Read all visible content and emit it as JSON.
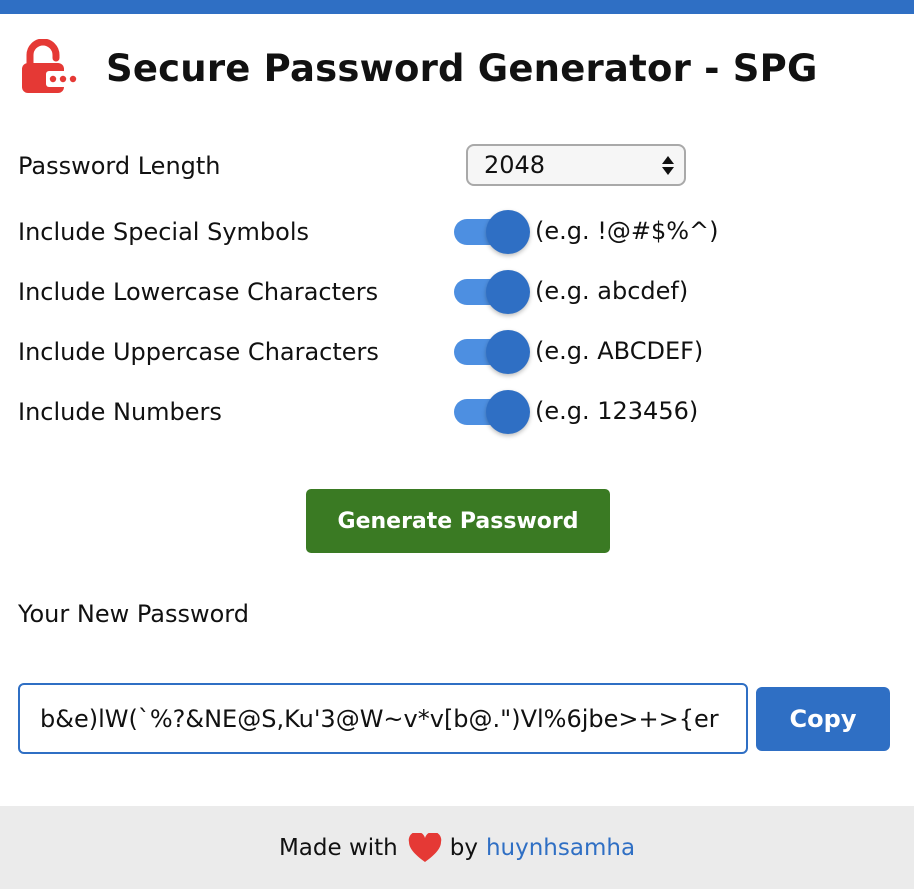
{
  "colors": {
    "accent": "#2f6fc4",
    "toggle_track": "#4d8fe1",
    "generate_button": "#3a7a23",
    "lock_icon": "#e53935",
    "heart_icon": "#e53935",
    "footer_bg": "#ebebeb"
  },
  "header": {
    "icon": "lock-icon",
    "title": "Secure Password Generator - SPG"
  },
  "options": {
    "length": {
      "label": "Password Length",
      "value": "2048"
    },
    "special": {
      "label": "Include Special Symbols",
      "example": "(e.g. !@#$%^)",
      "checked": true
    },
    "lowercase": {
      "label": "Include Lowercase Characters",
      "example": "(e.g. abcdef)",
      "checked": true
    },
    "uppercase": {
      "label": "Include Uppercase Characters",
      "example": "(e.g. ABCDEF)",
      "checked": true
    },
    "numbers": {
      "label": "Include Numbers",
      "example": "(e.g. 123456)",
      "checked": true
    }
  },
  "generate_button": {
    "label": "Generate Password"
  },
  "result": {
    "label": "Your New Password",
    "password": "b&e)lW(`%?&NE@S,Ku'3@W~v*v[b@.\")Vl%6jbe>+>{er",
    "copy_label": "Copy"
  },
  "footer": {
    "made_with": "Made with",
    "heart_icon": "heart-icon",
    "by": "by",
    "author": "huynhsamha"
  }
}
